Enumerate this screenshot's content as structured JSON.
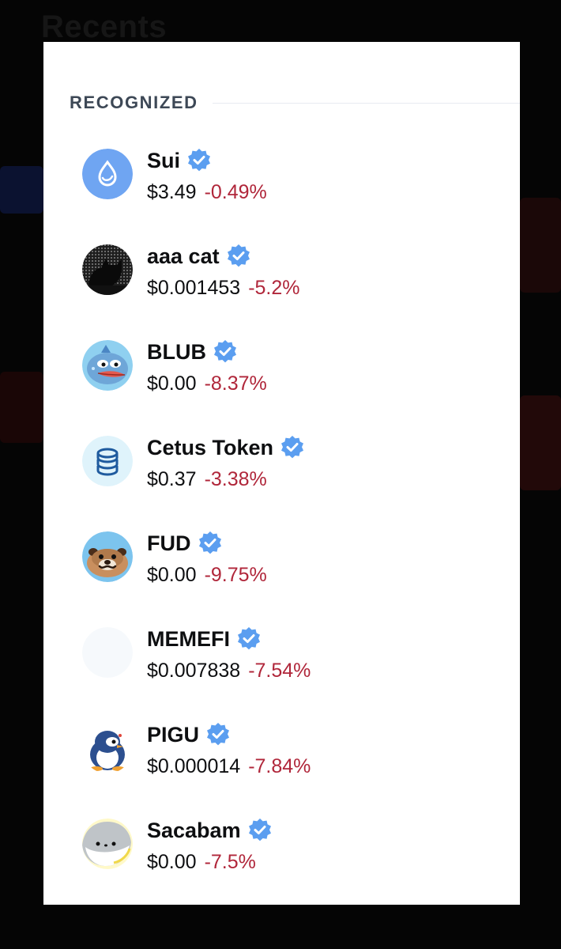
{
  "background": {
    "title": "Recents"
  },
  "section": {
    "title": "RECOGNIZED"
  },
  "colors": {
    "negative": "#b0263a",
    "verified": "#5b9ef0",
    "text": "#0e0f11",
    "section_title": "#3d4856"
  },
  "tokens": [
    {
      "name": "Sui",
      "price": "$3.49",
      "change": "-0.49%",
      "icon": "sui-droplet-icon",
      "verified": true
    },
    {
      "name": "aaa cat",
      "price": "$0.001453",
      "change": "-5.2%",
      "icon": "black-cat-icon",
      "verified": true
    },
    {
      "name": "BLUB",
      "price": "$0.00",
      "change": "-8.37%",
      "icon": "blub-fish-icon",
      "verified": true
    },
    {
      "name": "Cetus Token",
      "price": "$0.37",
      "change": "-3.38%",
      "icon": "cetus-coins-icon",
      "verified": true
    },
    {
      "name": "FUD",
      "price": "$0.00",
      "change": "-9.75%",
      "icon": "fud-pug-icon",
      "verified": true
    },
    {
      "name": "MEMEFI",
      "price": "$0.007838",
      "change": "-7.54%",
      "icon": "memefi-placeholder-icon",
      "verified": true
    },
    {
      "name": "PIGU",
      "price": "$0.000014",
      "change": "-7.84%",
      "icon": "pigu-penguin-icon",
      "verified": true
    },
    {
      "name": "Sacabam",
      "price": "$0.00",
      "change": "-7.5%",
      "icon": "sacabam-fish-icon",
      "verified": true
    }
  ]
}
